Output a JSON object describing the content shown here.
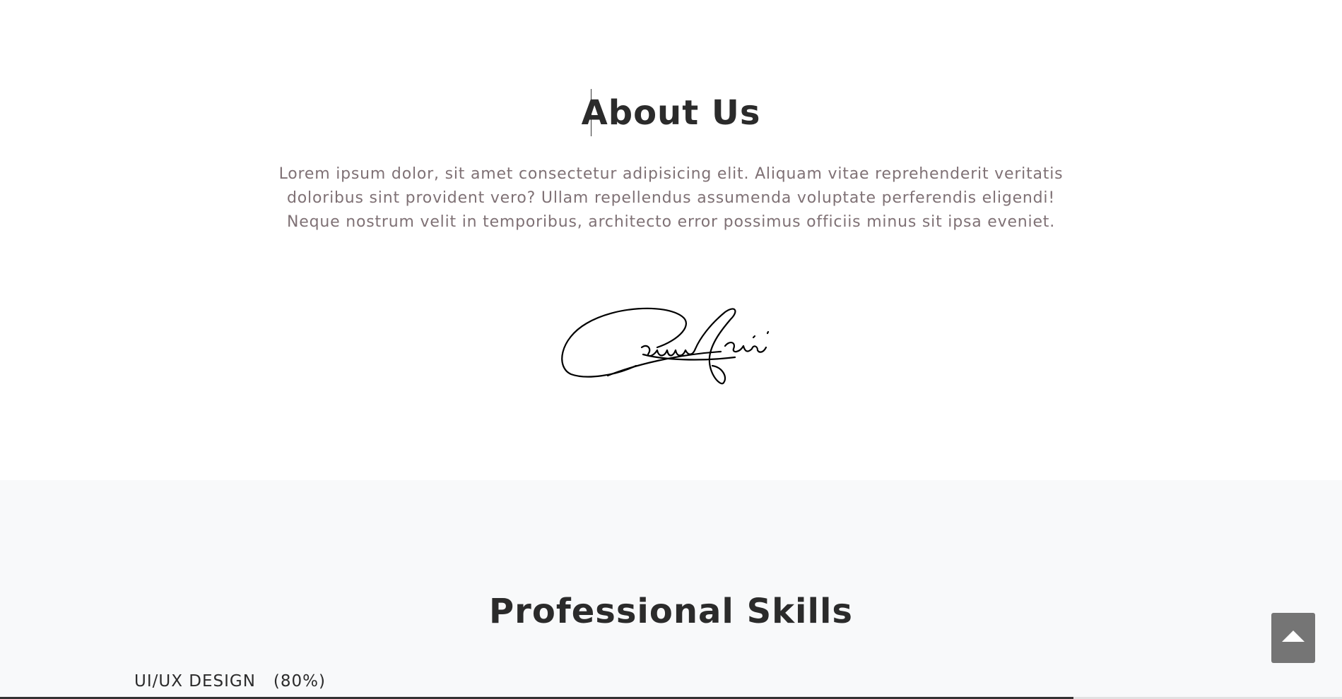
{
  "about": {
    "title": "About Us",
    "text": "Lorem ipsum dolor, sit amet consectetur adipisicing elit. Aliquam vitae reprehenderit veritatis doloribus sint provident vero? Ullam repellendus assumenda voluptate perferendis eligendi! Neque nostrum velit in temporibus, architecto error possimus officiis minus sit ipsa eveniet.",
    "signature_icon": "handwritten-signature"
  },
  "skills": {
    "title": "Professional Skills",
    "items": [
      {
        "label": "UI/UX DESIGN   (80%)",
        "level_percent": 80
      }
    ]
  },
  "back_to_top": {
    "icon": "triangle-up-icon",
    "color": "#757575"
  },
  "colors": {
    "heading": "#2b2b2b",
    "body_text": "#7f7175",
    "skills_background": "#f8f9fa"
  }
}
